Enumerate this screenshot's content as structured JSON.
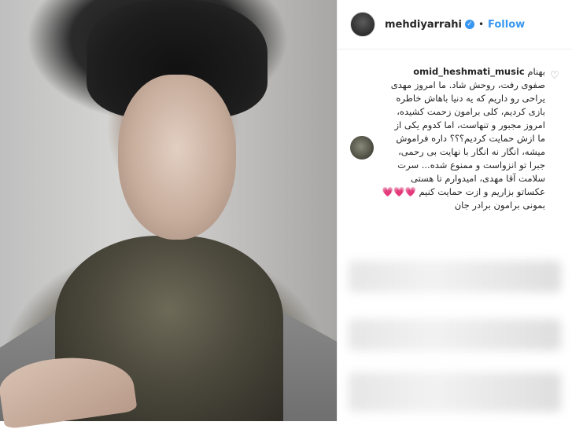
{
  "post": {
    "username": "mehdiyarrahi",
    "separator": "•",
    "follow_label": "Follow"
  },
  "comment": {
    "prefix": "بهنام",
    "username": "omid_heshmati_music",
    "text": "صفوی رفت، روحش شاد. ما امروز مهدی\nیراحی رو داریم که یه دنیا باهاش خاطره\nبازی کردیم، کلی برامون زحمت کشیده،\nامروز مجبور و تنهاست، اما کدوم یکی از\nما ازش حمایت کردیم؟؟؟ داره فراموش\nمیشه، انگار نه انگار با نهایت بی رحمی،\nجبرا تو انزواست و ممنوع شده... سرت\nسلامت آقا مهدی، امیدوارم تا هستی\nعکساتو بزاریم و ازت حمایت کنیم 💗💗💗\nبمونی برامون برادر جان"
  },
  "icons": {
    "verified": "verified-badge-icon",
    "like": "heart-icon"
  },
  "colors": {
    "accent": "#3897f0",
    "text": "#262626"
  }
}
